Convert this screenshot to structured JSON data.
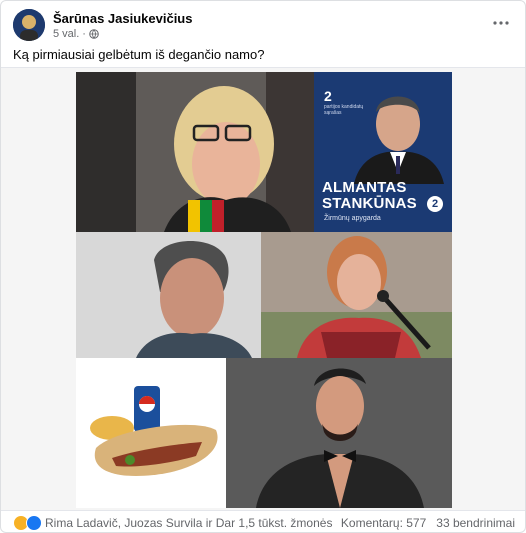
{
  "post": {
    "author": "Šarūnas Jasiukevičius",
    "time": "5 val.",
    "separator": "·",
    "text": "Ką pirmiausiai gelbėtum iš degančio namo?"
  },
  "poster": {
    "number": "2",
    "small_text": "partijos kandidatų sąrašas",
    "name_line1": "ALMANTAS",
    "name_line2": "STANKŪNAS",
    "area": "Žirmūnų apygarda",
    "badge": "2"
  },
  "footer": {
    "reactors": "Rima Ladavič, Juozas Survila ir Dar 1,5 tūkst. žmonės",
    "comments": "Komentarų: 577",
    "shares": "33 bendrinimai"
  },
  "icons": {
    "more": "more-options-icon",
    "privacy": "globe-icon",
    "reaction_haha": "haha-reaction-icon",
    "reaction_like": "like-reaction-icon"
  },
  "colors": {
    "poster_blue": "#1b3a73",
    "like_blue": "#1877f2",
    "haha_yellow": "#f7b125",
    "meta_gray": "#65676b"
  }
}
